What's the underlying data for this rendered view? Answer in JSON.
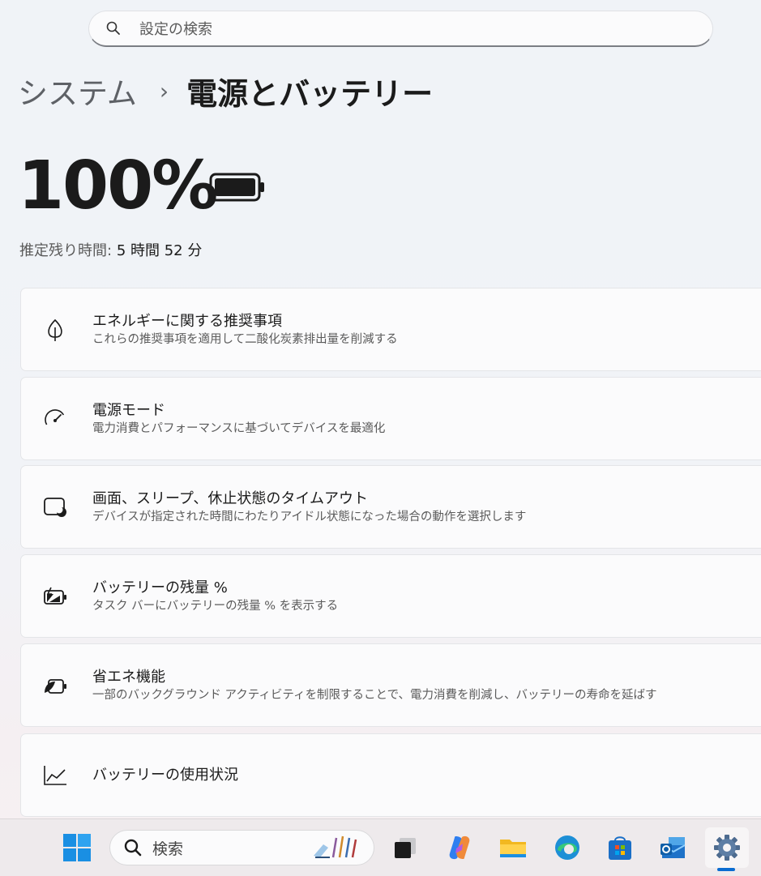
{
  "search": {
    "placeholder": "設定の検索"
  },
  "breadcrumb": {
    "parent": "システム",
    "separator": "›",
    "current": "電源とバッテリー"
  },
  "battery": {
    "percent_text": "100%",
    "level": 1.0,
    "estimate_label": "推定残り時間:",
    "estimate_value": "5 時間 52 分"
  },
  "items": [
    {
      "title": "エネルギーに関する推奨事項",
      "desc": "これらの推奨事項を適用して二酸化炭素排出量を削減する",
      "icon": "leaf-icon"
    },
    {
      "title": "電源モード",
      "desc": "電力消費とパフォーマンスに基づいてデバイスを最適化",
      "icon": "gauge-icon"
    },
    {
      "title": "画面、スリープ、休止状態のタイムアウト",
      "desc": "デバイスが指定された時間にわたりアイドル状態になった場合の動作を選択します",
      "icon": "sleep-icon"
    },
    {
      "title": "バッテリーの残量 %",
      "desc": "タスク バーにバッテリーの残量 % を表示する",
      "icon": "battery-charge-icon"
    },
    {
      "title": "省エネ機能",
      "desc": "一部のバックグラウンド アクティビティを制限することで、電力消費を削減し、バッテリーの寿命を延ばす",
      "icon": "battery-saver-icon"
    },
    {
      "title": "バッテリーの使用状況",
      "desc": "",
      "icon": "usage-chart-icon"
    }
  ],
  "taskbar": {
    "search_label": "検索",
    "apps": [
      "start-icon",
      "task-view-icon",
      "copilot-icon",
      "file-explorer-icon",
      "edge-icon",
      "store-icon",
      "outlook-icon",
      "settings-icon"
    ],
    "colors": {
      "accent": "#0a6cd1"
    }
  }
}
